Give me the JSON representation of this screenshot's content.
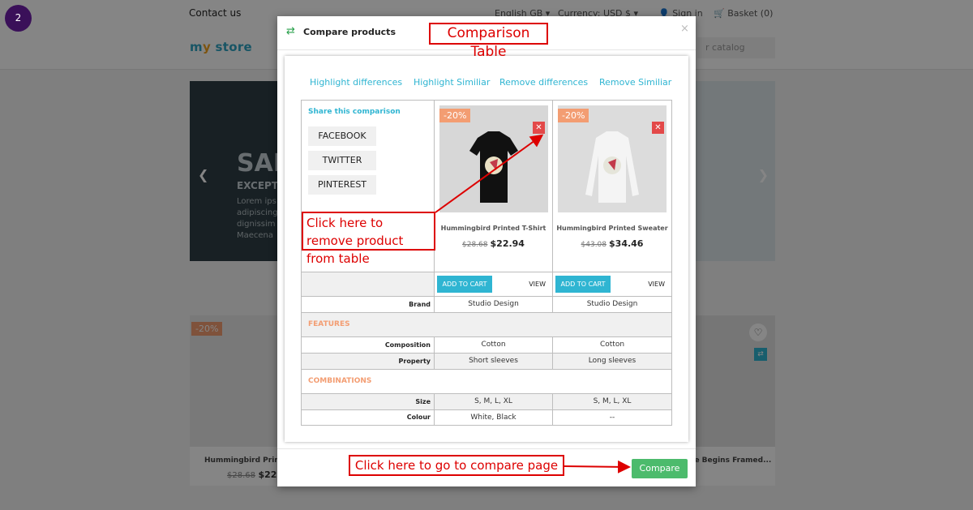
{
  "step_badge": "2",
  "store": {
    "contact": "Contact us",
    "language": "English GB ▾",
    "currency": "Currency: USD $ ▾",
    "sign_in": "Sign in",
    "basket": "Basket (0)",
    "logo_part1": "m",
    "logo_part2": "y",
    "logo_part3": " store",
    "search_placeholder": "r catalog",
    "slider": {
      "title": "SAM",
      "subtitle": "EXCEPT",
      "text": "Lorem ips adipiscing dignissim Maecena"
    },
    "products": [
      {
        "discount": "-20%",
        "name": "Hummingbird Printe",
        "old_price": "$28.68",
        "price": "$22.9"
      },
      {
        "name": "re Begins Framed..."
      }
    ]
  },
  "modal": {
    "title": "Compare products",
    "close": "×",
    "controls": [
      "Highlight differences",
      "Highlight Similiar",
      "Remove differences",
      "Remove Similiar"
    ],
    "share": {
      "title": "Share this comparison",
      "buttons": [
        "FACEBOOK",
        "TWITTER",
        "PINTEREST"
      ]
    },
    "products": [
      {
        "discount": "-20%",
        "name": "Hummingbird Printed T-Shirt",
        "old_price": "$28.68",
        "price": "$22.94",
        "add_to_cart": "ADD TO CART",
        "view": "VIEW",
        "brand": "Studio Design",
        "composition": "Cotton",
        "property": "Short sleeves",
        "size": "S, M, L, XL",
        "colour": "White, Black"
      },
      {
        "discount": "-20%",
        "name": "Hummingbird Printed Sweater",
        "old_price": "$43.08",
        "price": "$34.46",
        "add_to_cart": "ADD TO CART",
        "view": "VIEW",
        "brand": "Studio Design",
        "composition": "Cotton",
        "property": "Long sleeves",
        "size": "S, M, L, XL",
        "colour": "--"
      }
    ],
    "labels": {
      "brand": "Brand",
      "features": "FEATURES",
      "composition": "Composition",
      "property": "Property",
      "combinations": "COMBINATIONS",
      "size": "Size",
      "colour": "Colour"
    },
    "compare_button": "Compare"
  },
  "annotations": {
    "table": "Comparison Table",
    "remove": "Click here to remove product from table",
    "compare_page": "Click here to go to compare page"
  },
  "colors": {
    "accent": "#2fb5d2",
    "discount": "#f39d72",
    "compare_green": "#4cbb6c",
    "annotation_red": "#dd0000",
    "remove_red": "#e34949"
  }
}
